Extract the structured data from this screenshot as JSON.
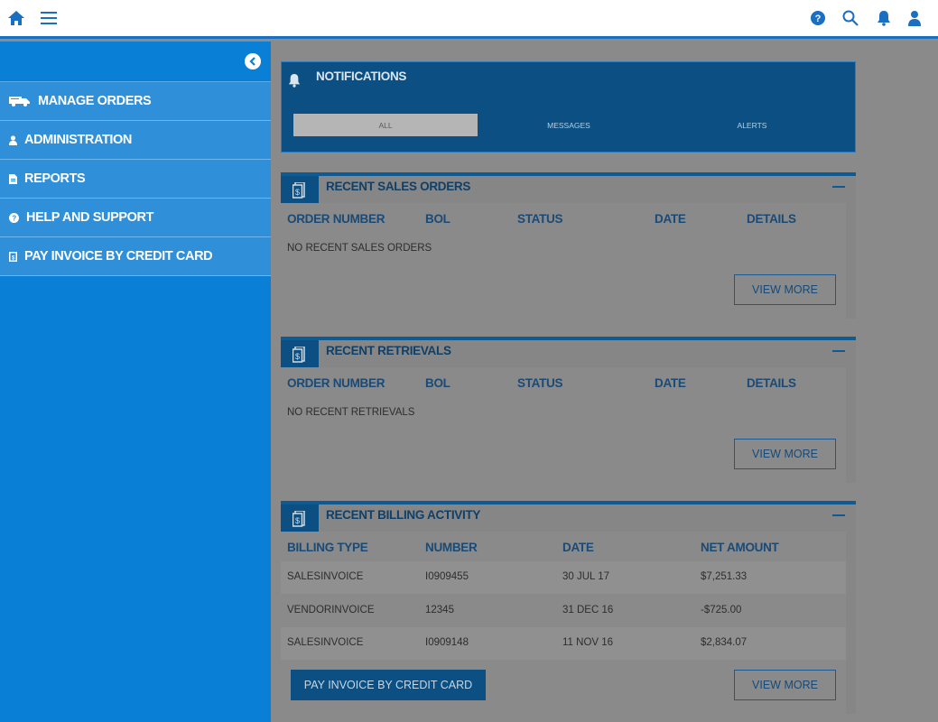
{
  "topbar": {
    "icons": [
      "home-icon",
      "menu-icon",
      "help-icon",
      "search-icon",
      "bell-icon",
      "user-icon"
    ]
  },
  "sidebar": {
    "items": [
      {
        "label": "MANAGE ORDERS",
        "icon": "truck-icon"
      },
      {
        "label": "ADMINISTRATION",
        "icon": "person-icon"
      },
      {
        "label": "REPORTS",
        "icon": "document-icon"
      },
      {
        "label": "HELP AND SUPPORT",
        "icon": "help-icon"
      },
      {
        "label": "PAY INVOICE BY CREDIT CARD",
        "icon": "invoice-icon"
      }
    ]
  },
  "notifications": {
    "title": "NOTIFICATIONS",
    "tabs": [
      "ALL",
      "MESSAGES",
      "ALERTS"
    ],
    "active_tab": "ALL"
  },
  "sales_orders": {
    "title": "RECENT SALES ORDERS",
    "columns": [
      "ORDER NUMBER",
      "BOL",
      "STATUS",
      "DATE",
      "DETAILS"
    ],
    "empty": "NO RECENT SALES ORDERS",
    "view_more": "VIEW MORE"
  },
  "retrievals": {
    "title": "RECENT RETRIEVALS",
    "columns": [
      "ORDER NUMBER",
      "BOL",
      "STATUS",
      "DATE",
      "DETAILS"
    ],
    "empty": "NO RECENT RETRIEVALS",
    "view_more": "VIEW MORE"
  },
  "billing": {
    "title": "RECENT BILLING ACTIVITY",
    "columns": [
      "BILLING TYPE",
      "NUMBER",
      "DATE",
      "NET AMOUNT"
    ],
    "rows": [
      [
        "SALESINVOICE",
        "I0909455",
        "30 JUL 17",
        "$7,251.33"
      ],
      [
        "VENDORINVOICE",
        "12345",
        "31 DEC 16",
        "-$725.00"
      ],
      [
        "SALESINVOICE",
        "I0909148",
        "11 NOV 16",
        "$2,834.07"
      ]
    ],
    "pay_button": "PAY INVOICE BY CREDIT CARD",
    "view_more": "VIEW MORE"
  },
  "colors": {
    "accent": "#0a7fd6",
    "dark_blue": "#0c4f82",
    "overlay_gray": "#8a8a8a"
  }
}
